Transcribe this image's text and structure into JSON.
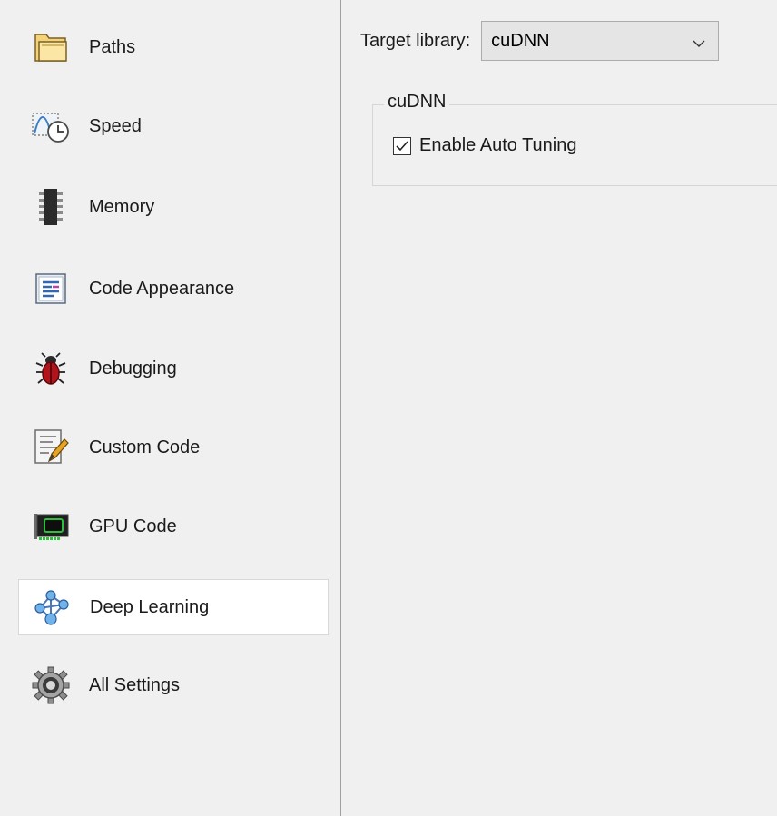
{
  "sidebar": {
    "items": [
      {
        "label": "Paths",
        "icon": "folder-icon"
      },
      {
        "label": "Speed",
        "icon": "speed-clock-icon"
      },
      {
        "label": "Memory",
        "icon": "memory-chip-icon"
      },
      {
        "label": "Code Appearance",
        "icon": "code-appearance-icon"
      },
      {
        "label": "Debugging",
        "icon": "bug-icon"
      },
      {
        "label": "Custom Code",
        "icon": "custom-code-icon"
      },
      {
        "label": "GPU Code",
        "icon": "gpu-card-icon"
      },
      {
        "label": "Deep Learning",
        "icon": "network-nodes-icon",
        "selected": true
      },
      {
        "label": "All Settings",
        "icon": "gear-icon"
      }
    ]
  },
  "main": {
    "target_library_label": "Target library:",
    "target_library_value": "cuDNN",
    "group_title": "cuDNN",
    "auto_tuning_label": "Enable Auto Tuning",
    "auto_tuning_checked": true
  },
  "colors": {
    "background": "#f0f0f0",
    "selected_bg": "#ffffff",
    "select_bg": "#e5e5e5"
  }
}
